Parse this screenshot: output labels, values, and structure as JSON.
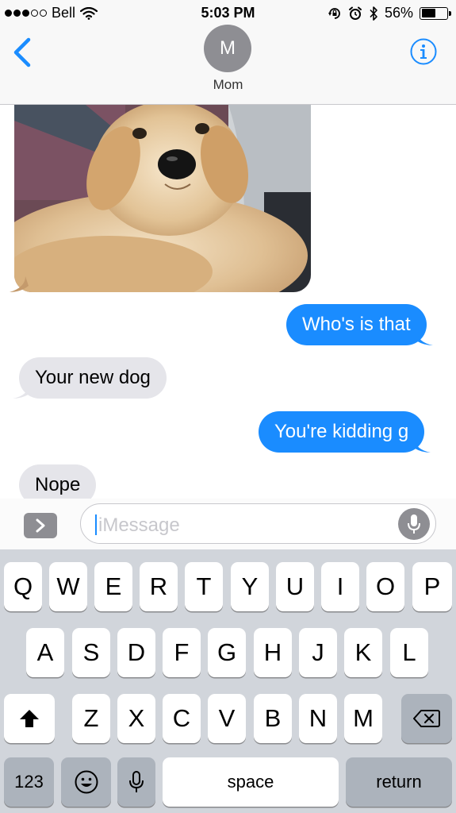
{
  "status_bar": {
    "carrier": "Bell",
    "time": "5:03 PM",
    "battery_percent": "56%",
    "battery_level": 0.56
  },
  "header": {
    "avatar_initial": "M",
    "contact_name": "Mom"
  },
  "messages": [
    {
      "direction": "incoming",
      "type": "photo",
      "description_icon": "dog-photo"
    },
    {
      "direction": "outgoing",
      "text": "Who's is that"
    },
    {
      "direction": "incoming",
      "text": "Your new dog"
    },
    {
      "direction": "outgoing",
      "text": "You're kidding g"
    },
    {
      "direction": "incoming",
      "text": "Nope"
    }
  ],
  "input": {
    "placeholder": "iMessage"
  },
  "keyboard": {
    "row1": [
      "Q",
      "W",
      "E",
      "R",
      "T",
      "Y",
      "U",
      "I",
      "O",
      "P"
    ],
    "row2": [
      "A",
      "S",
      "D",
      "F",
      "G",
      "H",
      "J",
      "K",
      "L"
    ],
    "row3": [
      "Z",
      "X",
      "C",
      "V",
      "B",
      "N",
      "M"
    ],
    "numbers_label": "123",
    "space_label": "space",
    "return_label": "return"
  },
  "colors": {
    "accent": "#1a8cff",
    "incoming_bubble": "#e5e5ea",
    "keyboard_bg": "#d1d5db"
  }
}
